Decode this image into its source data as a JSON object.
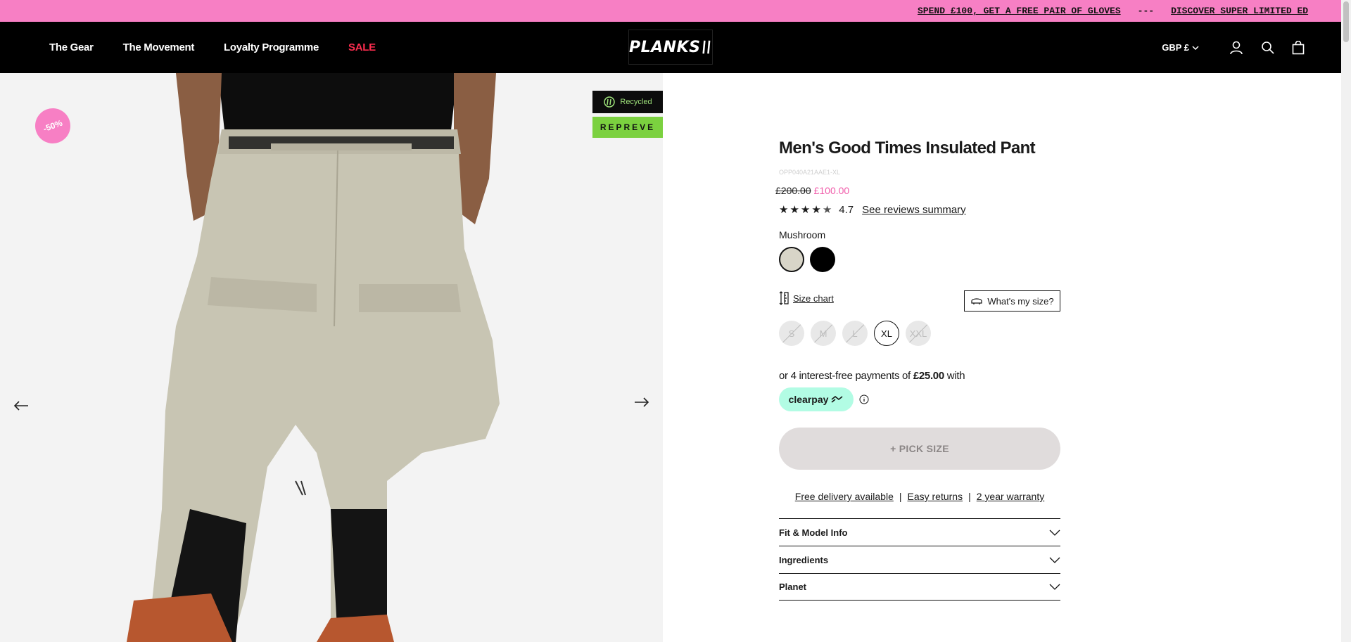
{
  "announcement": {
    "message1": "SPEND £100, GET A FREE PAIR OF GLOVES",
    "separator": "---",
    "message2": "DISCOVER SUPER LIMITED ED"
  },
  "header": {
    "nav": [
      "The Gear",
      "The Movement",
      "Loyalty Programme",
      "SALE"
    ],
    "logo": "PLANKS",
    "currency": "GBP £"
  },
  "gallery": {
    "discount_badge": "-50%",
    "tag_recycled": "Recycled",
    "tag_repreve": "REPREVE"
  },
  "product": {
    "title": "Men's Good Times Insulated Pant",
    "sku": "OPP040A21AAE1-XL",
    "old_price": "£200.00",
    "new_price": "£100.00",
    "rating": 4.7,
    "rating_text": "4.7",
    "reviews_link": "See reviews summary",
    "color_label": "Mushroom",
    "colors": [
      {
        "name": "Mushroom",
        "hex": "#d8d5c8"
      },
      {
        "name": "Black",
        "hex": "#000000"
      }
    ],
    "size_chart": "Size chart",
    "whats_my_size": "What's my size?",
    "sizes": [
      {
        "label": "S",
        "available": false
      },
      {
        "label": "M",
        "available": false
      },
      {
        "label": "L",
        "available": false
      },
      {
        "label": "XL",
        "available": true,
        "selected": true
      },
      {
        "label": "XXL",
        "available": false
      }
    ],
    "installments_prefix": "or 4 interest-free payments of",
    "installments_amount": "£25.00",
    "installments_suffix": "with",
    "clearpay": "clearpay",
    "pick_size": "+ PICK SIZE",
    "perks": [
      "Free delivery available",
      "Easy returns",
      "2 year warranty"
    ],
    "perk_separator": "|",
    "accordion": [
      "Fit & Model Info",
      "Ingredients",
      "Planet"
    ]
  },
  "colors": {
    "accent_pink": "#f77fc4",
    "sale_red": "#ff2d4f",
    "price_pink": "#f05aa9",
    "clearpay_mint": "#b2fce4"
  }
}
